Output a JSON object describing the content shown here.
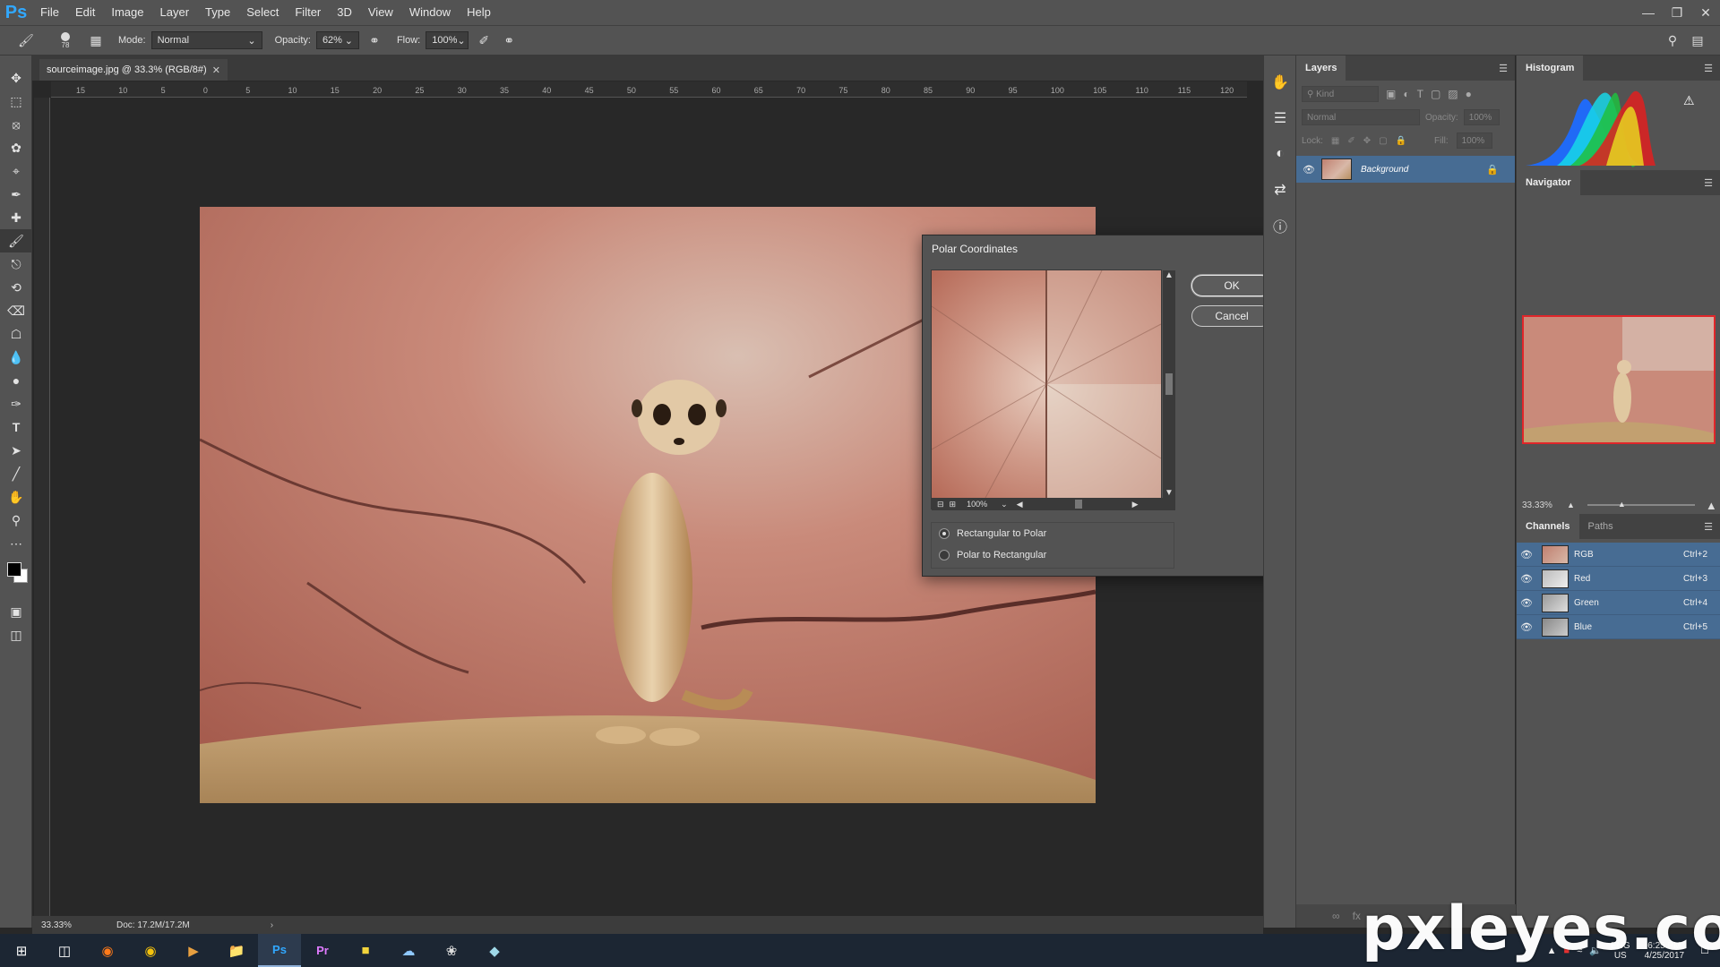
{
  "app": {
    "logo": "Ps",
    "menu": [
      "File",
      "Edit",
      "Image",
      "Layer",
      "Type",
      "Select",
      "Filter",
      "3D",
      "View",
      "Window",
      "Help"
    ],
    "window_controls": [
      "minimize",
      "restore",
      "close"
    ]
  },
  "options": {
    "brush_size": "78",
    "mode_label": "Mode:",
    "mode_value": "Normal",
    "opacity_label": "Opacity:",
    "opacity_value": "62%",
    "flow_label": "Flow:",
    "flow_value": "100%"
  },
  "tools": [
    "move-icon",
    "marquee-icon",
    "lasso-icon",
    "quick-select-icon",
    "crop-icon",
    "eyedropper-icon",
    "healing-icon",
    "brush-icon",
    "stamp-icon",
    "history-brush-icon",
    "eraser-icon",
    "paint-bucket-icon",
    "blur-icon",
    "dodge-icon",
    "pen-icon",
    "type-icon",
    "path-select-icon",
    "line-icon",
    "hand-icon",
    "zoom-icon",
    "more-icon"
  ],
  "document": {
    "tab_title": "sourceimage.jpg @ 33.3% (RGB/8#)",
    "ruler_top": [
      "15",
      "10",
      "5",
      "0",
      "5",
      "10",
      "15",
      "20",
      "25",
      "30",
      "35",
      "40",
      "45",
      "50",
      "55",
      "60",
      "65",
      "70",
      "75",
      "80",
      "85",
      "90",
      "95",
      "100",
      "105",
      "110",
      "115",
      "120"
    ],
    "zoom": "33.33%",
    "doc_size": "Doc: 17.2M/17.2M"
  },
  "dialog": {
    "title": "Polar Coordinates",
    "ok": "OK",
    "cancel": "Cancel",
    "preview_zoom": "100%",
    "options": [
      {
        "label": "Rectangular to Polar",
        "selected": true
      },
      {
        "label": "Polar to Rectangular",
        "selected": false
      }
    ]
  },
  "layers": {
    "tab": "Layers",
    "kind": "Kind",
    "blend": "Normal",
    "opacity_label": "Opacity:",
    "opacity_value": "100%",
    "lock_label": "Lock:",
    "fill_label": "Fill:",
    "fill_value": "100%",
    "items": [
      {
        "name": "Background",
        "locked": true
      }
    ]
  },
  "histogram": {
    "tab": "Histogram"
  },
  "navigator": {
    "tab": "Navigator",
    "zoom": "33.33%"
  },
  "channels": {
    "tabs": [
      "Channels",
      "Paths"
    ],
    "items": [
      {
        "name": "RGB",
        "shortcut": "Ctrl+2"
      },
      {
        "name": "Red",
        "shortcut": "Ctrl+3"
      },
      {
        "name": "Green",
        "shortcut": "Ctrl+4"
      },
      {
        "name": "Blue",
        "shortcut": "Ctrl+5"
      }
    ]
  },
  "taskbar": {
    "apps": [
      "start-icon",
      "task-view-icon",
      "firefox-icon",
      "chrome-icon",
      "media-player-icon",
      "file-explorer-icon",
      "photoshop-icon",
      "premiere-icon",
      "sticky-notes-icon",
      "onedrive-icon",
      "paint-icon",
      "app-icon"
    ],
    "lang": "ENG",
    "region": "US",
    "time": "6:25 PM",
    "date": "4/25/2017"
  },
  "watermark": "pxleyes.com",
  "colors": {
    "ui_panel": "#535353",
    "canvas_bg": "#282828",
    "selection": "#476c93",
    "navigator_frame": "#e0262a"
  }
}
